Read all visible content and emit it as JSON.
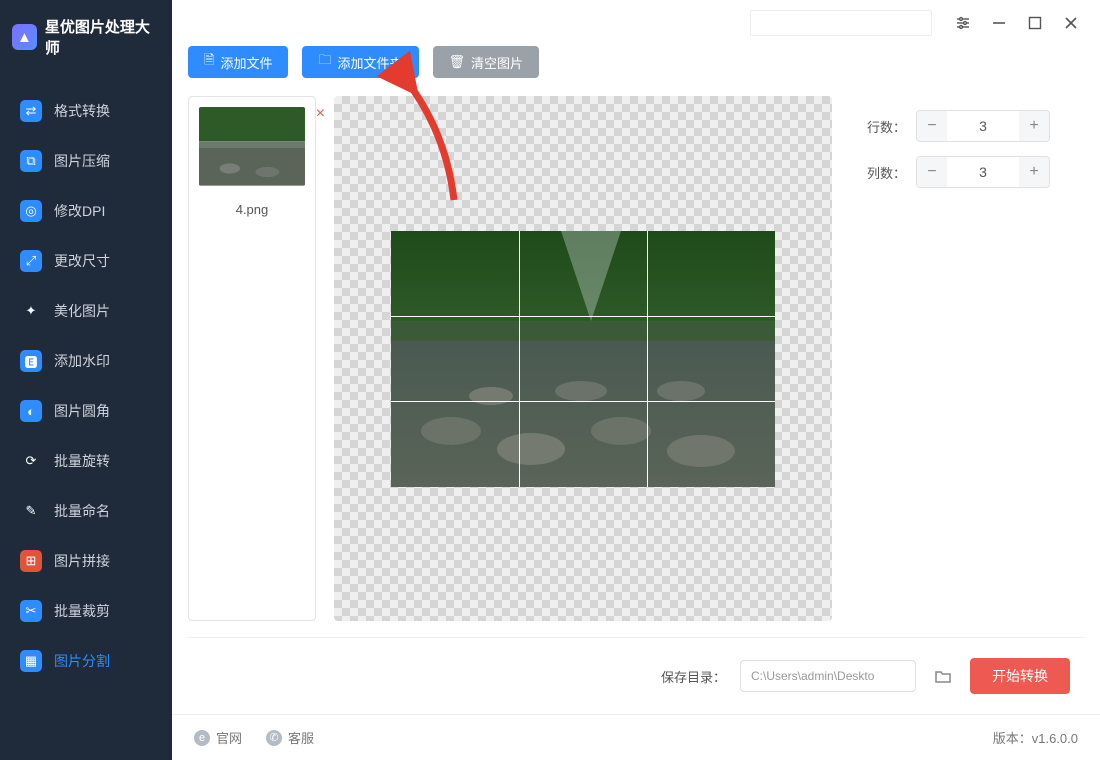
{
  "app": {
    "title": "星优图片处理大师"
  },
  "sidebar": {
    "items": [
      {
        "label": "格式转换",
        "icon_bg": "#2f8cff"
      },
      {
        "label": "图片压缩",
        "icon_bg": "#2f8cff"
      },
      {
        "label": "修改DPI",
        "icon_bg": "#2f8cff"
      },
      {
        "label": "更改尺寸",
        "icon_bg": "#2f8cff"
      },
      {
        "label": "美化图片",
        "icon_bg": "#1f2a3a"
      },
      {
        "label": "添加水印",
        "icon_bg": "#2f8cff"
      },
      {
        "label": "图片圆角",
        "icon_bg": "#2f8cff"
      },
      {
        "label": "批量旋转",
        "icon_bg": "#1f2a3a"
      },
      {
        "label": "批量命名",
        "icon_bg": "#1f2a3a"
      },
      {
        "label": "图片拼接",
        "icon_bg": "#e0543b"
      },
      {
        "label": "批量裁剪",
        "icon_bg": "#2f8cff"
      },
      {
        "label": "图片分割",
        "icon_bg": "#2f8cff",
        "active": true
      }
    ]
  },
  "toolbar": {
    "add_file": "添加文件",
    "add_folder": "添加文件夹",
    "clear": "清空图片"
  },
  "files": [
    {
      "name": "4.png"
    }
  ],
  "settings": {
    "rows_label": "行数：",
    "cols_label": "列数：",
    "rows": "3",
    "cols": "3"
  },
  "bottom": {
    "save_label": "保存目录：",
    "save_path": "C:\\Users\\admin\\Deskto",
    "start": "开始转换"
  },
  "footer": {
    "official": "官网",
    "support": "客服",
    "version_label": "版本：",
    "version": "v1.6.0.0"
  }
}
